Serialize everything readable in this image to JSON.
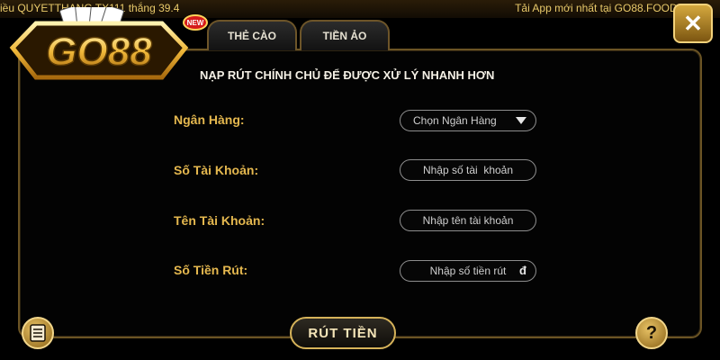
{
  "ticker": {
    "left_text": "iều QUYETTHANG TX111 thắng 39.4",
    "right_text": "Tải App mới nhất tại GO88.FOOD -"
  },
  "logo": {
    "text": "GO88",
    "badge": "NEW"
  },
  "tabs": [
    {
      "label": "THẺ CÀO"
    },
    {
      "label": "TIỀN ẢO"
    }
  ],
  "notice": "NẠP RÚT CHÍNH CHỦ ĐỂ ĐƯỢC XỬ LÝ NHANH HƠN",
  "form": {
    "bank_label": "Ngân Hàng:",
    "bank_select": "Chọn Ngân Hàng",
    "account_number_label": "Số Tài Khoản:",
    "account_number_placeholder": "Nhập số tài  khoản",
    "account_name_label": "Tên Tài Khoản:",
    "account_name_placeholder": "Nhập tên tài khoản",
    "amount_label": "Số Tiền Rút:",
    "amount_placeholder": "Nhập số tiền rút",
    "currency_symbol": "đ"
  },
  "submit_label": "RÚT TIỀN",
  "close_symbol": "✕",
  "help_symbol": "?",
  "colors": {
    "gold": "#e5b84f",
    "border": "#6b5424"
  }
}
